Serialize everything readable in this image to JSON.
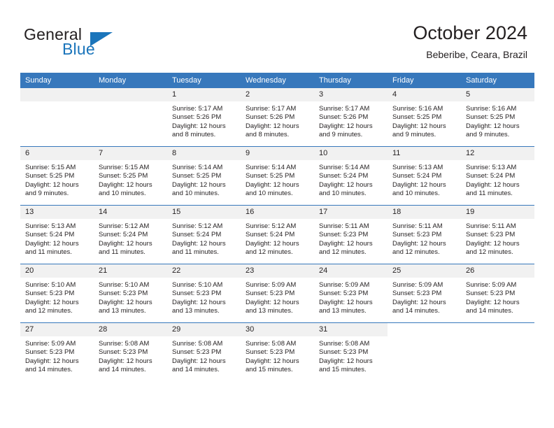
{
  "brand": {
    "name_part1": "General",
    "name_part2": "Blue"
  },
  "header": {
    "month_title": "October 2024",
    "location": "Beberibe, Ceara, Brazil"
  },
  "colors": {
    "header_blue": "#3778bc",
    "brand_blue": "#1b75bb",
    "daynum_bg": "#f1f1f1",
    "text": "#231f20"
  },
  "weekdays": [
    "Sunday",
    "Monday",
    "Tuesday",
    "Wednesday",
    "Thursday",
    "Friday",
    "Saturday"
  ],
  "weeks": [
    [
      {
        "day": "",
        "empty": true
      },
      {
        "day": "",
        "empty": true
      },
      {
        "day": "1",
        "sunrise": "Sunrise: 5:17 AM",
        "sunset": "Sunset: 5:26 PM",
        "daylight": "Daylight: 12 hours and 8 minutes."
      },
      {
        "day": "2",
        "sunrise": "Sunrise: 5:17 AM",
        "sunset": "Sunset: 5:26 PM",
        "daylight": "Daylight: 12 hours and 8 minutes."
      },
      {
        "day": "3",
        "sunrise": "Sunrise: 5:17 AM",
        "sunset": "Sunset: 5:26 PM",
        "daylight": "Daylight: 12 hours and 9 minutes."
      },
      {
        "day": "4",
        "sunrise": "Sunrise: 5:16 AM",
        "sunset": "Sunset: 5:25 PM",
        "daylight": "Daylight: 12 hours and 9 minutes."
      },
      {
        "day": "5",
        "sunrise": "Sunrise: 5:16 AM",
        "sunset": "Sunset: 5:25 PM",
        "daylight": "Daylight: 12 hours and 9 minutes."
      }
    ],
    [
      {
        "day": "6",
        "sunrise": "Sunrise: 5:15 AM",
        "sunset": "Sunset: 5:25 PM",
        "daylight": "Daylight: 12 hours and 9 minutes."
      },
      {
        "day": "7",
        "sunrise": "Sunrise: 5:15 AM",
        "sunset": "Sunset: 5:25 PM",
        "daylight": "Daylight: 12 hours and 10 minutes."
      },
      {
        "day": "8",
        "sunrise": "Sunrise: 5:14 AM",
        "sunset": "Sunset: 5:25 PM",
        "daylight": "Daylight: 12 hours and 10 minutes."
      },
      {
        "day": "9",
        "sunrise": "Sunrise: 5:14 AM",
        "sunset": "Sunset: 5:25 PM",
        "daylight": "Daylight: 12 hours and 10 minutes."
      },
      {
        "day": "10",
        "sunrise": "Sunrise: 5:14 AM",
        "sunset": "Sunset: 5:24 PM",
        "daylight": "Daylight: 12 hours and 10 minutes."
      },
      {
        "day": "11",
        "sunrise": "Sunrise: 5:13 AM",
        "sunset": "Sunset: 5:24 PM",
        "daylight": "Daylight: 12 hours and 10 minutes."
      },
      {
        "day": "12",
        "sunrise": "Sunrise: 5:13 AM",
        "sunset": "Sunset: 5:24 PM",
        "daylight": "Daylight: 12 hours and 11 minutes."
      }
    ],
    [
      {
        "day": "13",
        "sunrise": "Sunrise: 5:13 AM",
        "sunset": "Sunset: 5:24 PM",
        "daylight": "Daylight: 12 hours and 11 minutes."
      },
      {
        "day": "14",
        "sunrise": "Sunrise: 5:12 AM",
        "sunset": "Sunset: 5:24 PM",
        "daylight": "Daylight: 12 hours and 11 minutes."
      },
      {
        "day": "15",
        "sunrise": "Sunrise: 5:12 AM",
        "sunset": "Sunset: 5:24 PM",
        "daylight": "Daylight: 12 hours and 11 minutes."
      },
      {
        "day": "16",
        "sunrise": "Sunrise: 5:12 AM",
        "sunset": "Sunset: 5:24 PM",
        "daylight": "Daylight: 12 hours and 12 minutes."
      },
      {
        "day": "17",
        "sunrise": "Sunrise: 5:11 AM",
        "sunset": "Sunset: 5:23 PM",
        "daylight": "Daylight: 12 hours and 12 minutes."
      },
      {
        "day": "18",
        "sunrise": "Sunrise: 5:11 AM",
        "sunset": "Sunset: 5:23 PM",
        "daylight": "Daylight: 12 hours and 12 minutes."
      },
      {
        "day": "19",
        "sunrise": "Sunrise: 5:11 AM",
        "sunset": "Sunset: 5:23 PM",
        "daylight": "Daylight: 12 hours and 12 minutes."
      }
    ],
    [
      {
        "day": "20",
        "sunrise": "Sunrise: 5:10 AM",
        "sunset": "Sunset: 5:23 PM",
        "daylight": "Daylight: 12 hours and 12 minutes."
      },
      {
        "day": "21",
        "sunrise": "Sunrise: 5:10 AM",
        "sunset": "Sunset: 5:23 PM",
        "daylight": "Daylight: 12 hours and 13 minutes."
      },
      {
        "day": "22",
        "sunrise": "Sunrise: 5:10 AM",
        "sunset": "Sunset: 5:23 PM",
        "daylight": "Daylight: 12 hours and 13 minutes."
      },
      {
        "day": "23",
        "sunrise": "Sunrise: 5:09 AM",
        "sunset": "Sunset: 5:23 PM",
        "daylight": "Daylight: 12 hours and 13 minutes."
      },
      {
        "day": "24",
        "sunrise": "Sunrise: 5:09 AM",
        "sunset": "Sunset: 5:23 PM",
        "daylight": "Daylight: 12 hours and 13 minutes."
      },
      {
        "day": "25",
        "sunrise": "Sunrise: 5:09 AM",
        "sunset": "Sunset: 5:23 PM",
        "daylight": "Daylight: 12 hours and 14 minutes."
      },
      {
        "day": "26",
        "sunrise": "Sunrise: 5:09 AM",
        "sunset": "Sunset: 5:23 PM",
        "daylight": "Daylight: 12 hours and 14 minutes."
      }
    ],
    [
      {
        "day": "27",
        "sunrise": "Sunrise: 5:09 AM",
        "sunset": "Sunset: 5:23 PM",
        "daylight": "Daylight: 12 hours and 14 minutes."
      },
      {
        "day": "28",
        "sunrise": "Sunrise: 5:08 AM",
        "sunset": "Sunset: 5:23 PM",
        "daylight": "Daylight: 12 hours and 14 minutes."
      },
      {
        "day": "29",
        "sunrise": "Sunrise: 5:08 AM",
        "sunset": "Sunset: 5:23 PM",
        "daylight": "Daylight: 12 hours and 14 minutes."
      },
      {
        "day": "30",
        "sunrise": "Sunrise: 5:08 AM",
        "sunset": "Sunset: 5:23 PM",
        "daylight": "Daylight: 12 hours and 15 minutes."
      },
      {
        "day": "31",
        "sunrise": "Sunrise: 5:08 AM",
        "sunset": "Sunset: 5:23 PM",
        "daylight": "Daylight: 12 hours and 15 minutes."
      },
      {
        "day": "",
        "blank": true
      },
      {
        "day": "",
        "blank": true
      }
    ]
  ]
}
